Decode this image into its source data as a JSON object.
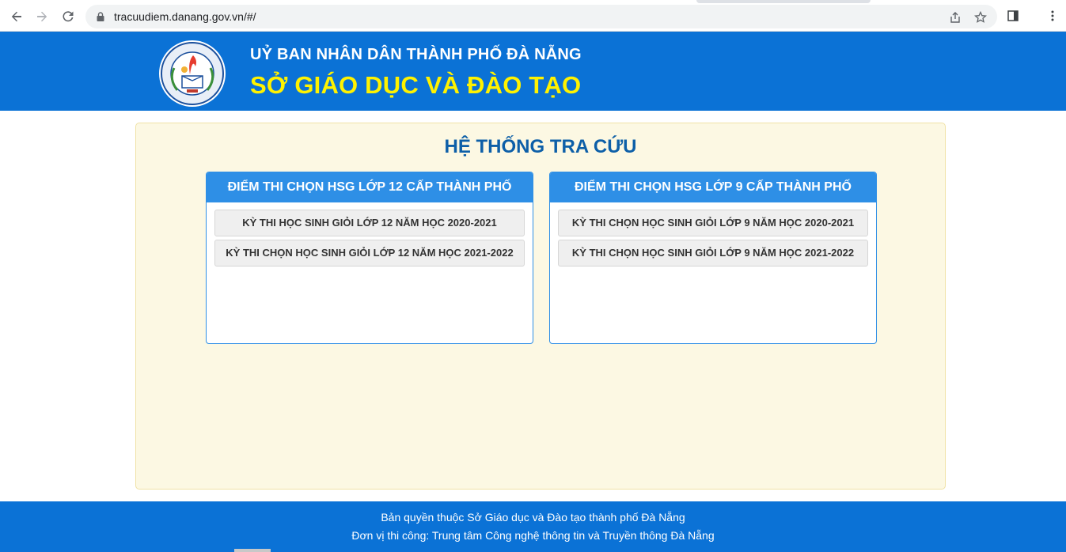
{
  "browser": {
    "url": "tracuudiem.danang.gov.vn/#/"
  },
  "header": {
    "org_name": "UỶ BAN NHÂN DÂN THÀNH PHỐ ĐÀ NẴNG",
    "dept_name": "SỞ GIÁO DỤC VÀ ĐÀO TẠO"
  },
  "main": {
    "title": "HỆ THỐNG TRA CỨU",
    "cards": [
      {
        "title": "ĐIỂM THI CHỌN HSG LỚP 12 CẤP THÀNH PHỐ",
        "items": [
          "KỲ THI HỌC SINH GIỎI LỚP 12 NĂM HỌC 2020-2021",
          "KỲ THI CHỌN HỌC SINH GIỎI LỚP 12 NĂM HỌC 2021-2022"
        ]
      },
      {
        "title": "ĐIỂM THI CHỌN HSG LỚP 9 CẤP THÀNH PHỐ",
        "items": [
          "KỲ THI CHỌN HỌC SINH GIỎI LỚP 9 NĂM HỌC 2020-2021",
          "KỲ THI CHỌN HỌC SINH GIỎI LỚP 9 NĂM HỌC 2021-2022"
        ]
      }
    ]
  },
  "footer": {
    "line1": "Bản quyền thuộc Sở Giáo dục và Đào tạo thành phố Đà Nẵng",
    "line2": "Đơn vị thi công: Trung tâm Công nghệ thông tin và Truyền thông Đà Nẵng"
  },
  "icons": {
    "back": "arrow-left-icon",
    "forward": "arrow-right-icon",
    "reload": "reload-icon",
    "lock": "lock-icon",
    "share": "share-icon",
    "bookmark": "star-icon",
    "sidepanel": "side-panel-icon",
    "menu": "kebab-menu-icon",
    "logo": "emblem-icon"
  },
  "colors": {
    "header_bg": "#0b72d6",
    "dept_title": "#fff200",
    "card_header": "#2e8fe6",
    "panel_bg": "#fcf8e3",
    "main_title": "#0d5fa8"
  }
}
